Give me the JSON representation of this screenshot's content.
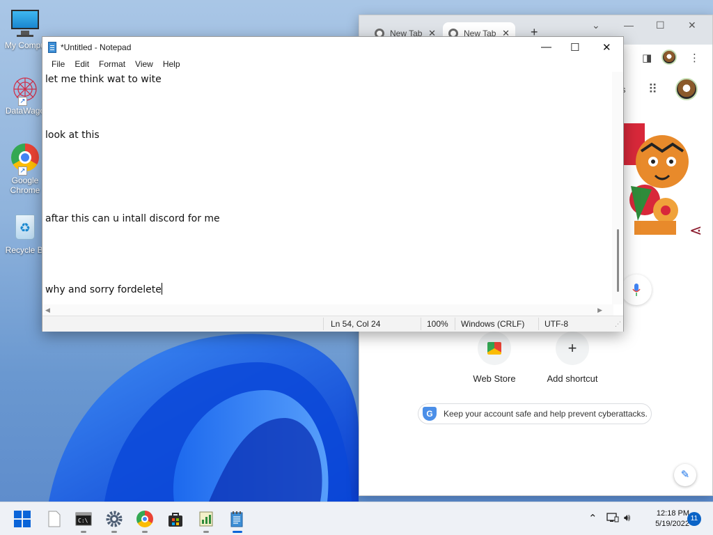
{
  "desktop": {
    "icons": [
      {
        "label": "My Compu"
      },
      {
        "label": "DataWago"
      },
      {
        "label": "Google Chrome"
      },
      {
        "label": "Recycle Bi"
      }
    ]
  },
  "chrome": {
    "tabs": [
      {
        "label": "New Tab"
      },
      {
        "label": "New Tab"
      }
    ],
    "gmail_fragment": "s",
    "shortcuts": [
      {
        "label": "Web Store"
      },
      {
        "label": "Add shortcut"
      }
    ],
    "add_symbol": "+",
    "promo_text": "Keep your account safe and help prevent cyberattacks."
  },
  "notepad": {
    "title": "*Untitled - Notepad",
    "menu": [
      "File",
      "Edit",
      "Format",
      "View",
      "Help"
    ],
    "lines": [
      "let me think wat to wite",
      "look at this",
      "aftar this can u intall discord for me",
      "why and sorry fordelete"
    ],
    "status": {
      "position": "Ln 54, Col 24",
      "zoom": "100%",
      "line_ending": "Windows (CRLF)",
      "encoding": "UTF-8"
    }
  },
  "taskbar": {
    "time": "12:18 PM",
    "date": "5/19/2022",
    "notification_count": "11"
  }
}
